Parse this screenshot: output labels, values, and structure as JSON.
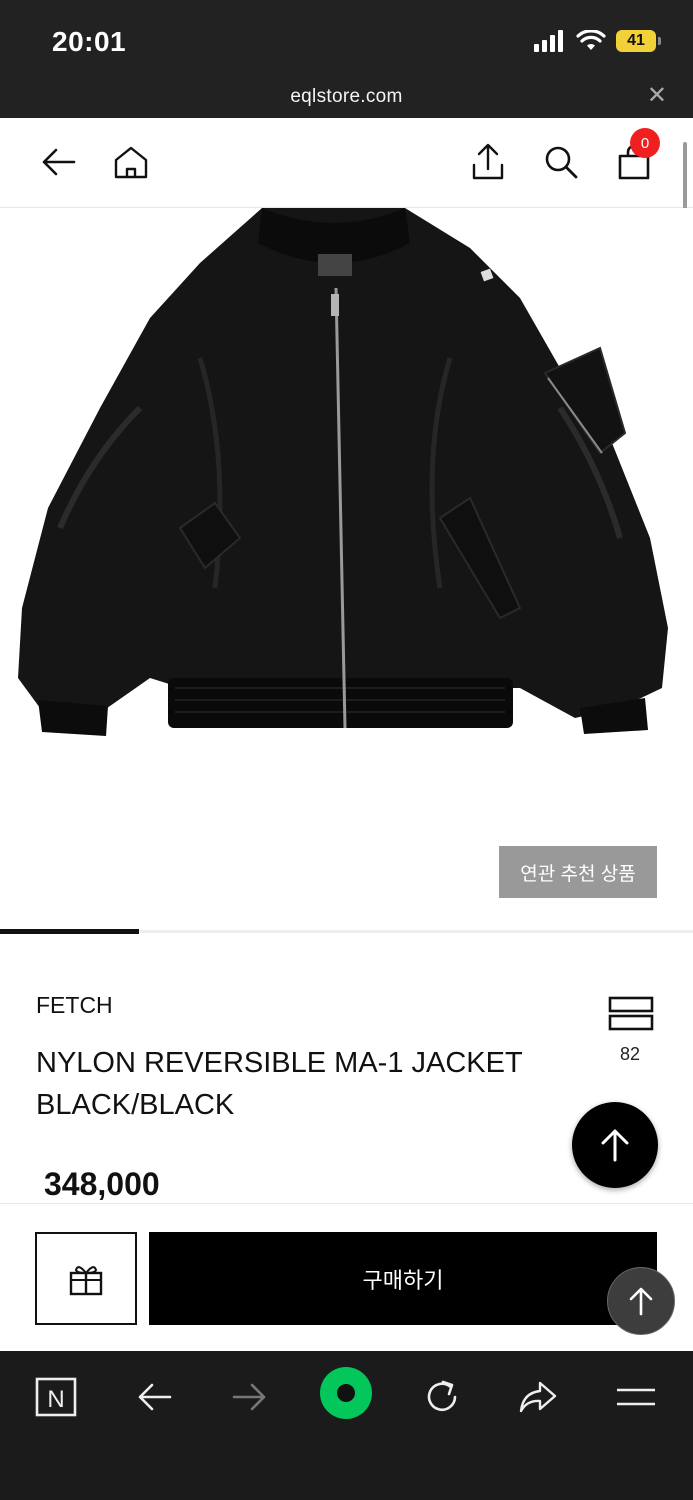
{
  "status_bar": {
    "time": "20:01",
    "battery": "41",
    "icons": [
      "signal-icon",
      "wifi-icon",
      "battery-icon"
    ]
  },
  "browser": {
    "url": "eqlstore.com",
    "close_icon": "close-icon"
  },
  "header": {
    "cart_count": "0",
    "icons": [
      "back-arrow-icon",
      "home-icon",
      "share-icon",
      "search-icon",
      "cart-icon"
    ]
  },
  "gallery": {
    "related_label": "연관 추천 상품",
    "image_progress": 0.2
  },
  "product": {
    "brand": "FETCH",
    "name": "NYLON REVERSIBLE MA-1 JACKET BLACK/BLACK",
    "like_count": "82",
    "price": "348,000"
  },
  "actions": {
    "buy_label": "구매하기",
    "gift_icon": "gift-icon"
  },
  "bottom_nav": {
    "icons": [
      "naver-n-icon",
      "back-icon",
      "forward-icon",
      "green-circle-icon",
      "refresh-icon",
      "share-arrow-icon",
      "menu-icon"
    ]
  },
  "colors": {
    "accent_badge": "#f02020",
    "naver_green": "#03c75a",
    "buy_button": "#000000"
  }
}
